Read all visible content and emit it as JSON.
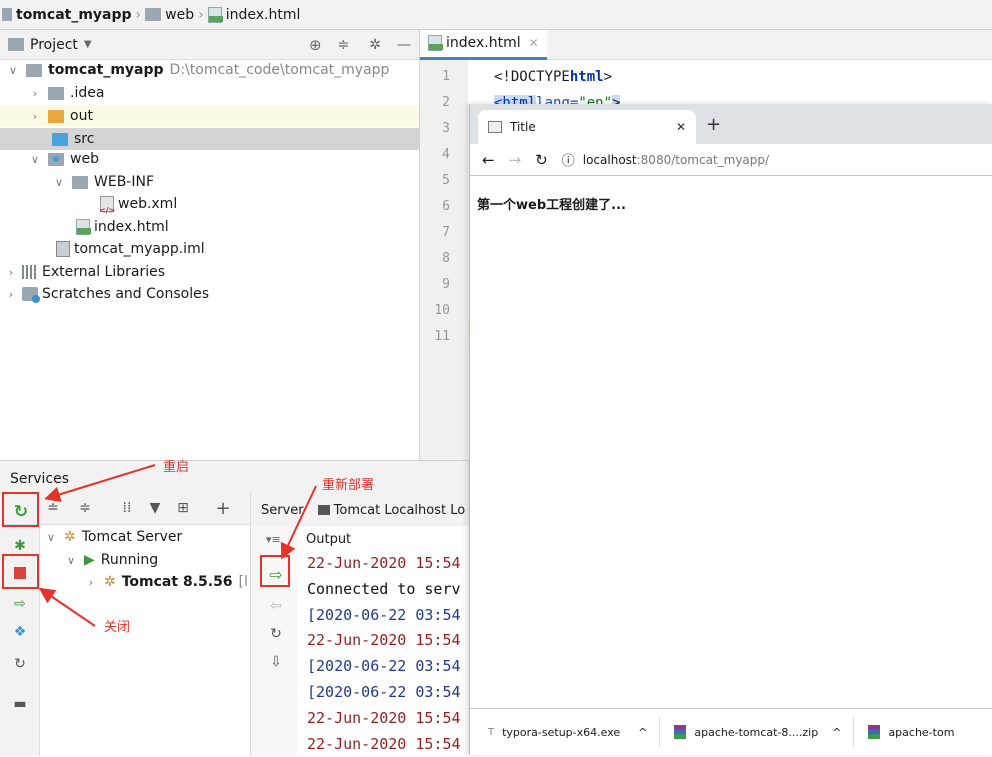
{
  "breadcrumb": {
    "project": "tomcat_myapp",
    "folder": "web",
    "file": "index.html"
  },
  "project_panel": {
    "title": "Project",
    "tree": {
      "root_name": "tomcat_myapp",
      "root_path": "D:\\tomcat_code\\tomcat_myapp",
      "idea": ".idea",
      "out": "out",
      "src": "src",
      "web": "web",
      "webinf": "WEB-INF",
      "webxml": "web.xml",
      "indexhtml": "index.html",
      "iml": "tomcat_myapp.iml",
      "extlibs": "External Libraries",
      "scratches": "Scratches and Consoles"
    }
  },
  "editor": {
    "tab": "index.html",
    "line_numbers": [
      "1",
      "2",
      "3",
      "4",
      "5",
      "6",
      "7",
      "8",
      "9",
      "10",
      "11"
    ],
    "line1_prefix": "<!DOCTYPE ",
    "line1_kw": "html",
    "line1_suffix": ">",
    "line2_open": "<html",
    "line2_attr": " lang=",
    "line2_val": "\"en\"",
    "line2_close": ">"
  },
  "browser": {
    "tab_title": "Title",
    "url_host": "localhost",
    "url_rest": ":8080/tomcat_myapp/",
    "page_text": "第一个web工程创建了...",
    "downloads": [
      "typora-setup-x64.exe",
      "apache-tomcat-8....zip",
      "apache-tom"
    ]
  },
  "services": {
    "title": "Services",
    "tree": {
      "server": "Tomcat Server",
      "running": "Running",
      "tomcat": "Tomcat 8.5.56",
      "tomcat_suffix": " [l"
    },
    "tabs": {
      "server": "Server",
      "localhost": "Tomcat Localhost Lo"
    },
    "output_label": "Output",
    "log": [
      "22-Jun-2020 15:54",
      "Connected to serv",
      "[2020-06-22 03:54",
      "22-Jun-2020 15:54",
      "[2020-06-22 03:54",
      "[2020-06-22 03:54",
      "22-Jun-2020 15:54",
      "22-Jun-2020 15:54"
    ]
  },
  "annotations": {
    "restart": "重启",
    "redeploy": "重新部署",
    "close": "关闭"
  },
  "colors": {
    "annotation": "#e6332a",
    "log_red": "#9b1d1d",
    "log_blue": "#1e3a8a",
    "selected_row": "#d4d4d4",
    "current_line": "#fcfae3"
  }
}
